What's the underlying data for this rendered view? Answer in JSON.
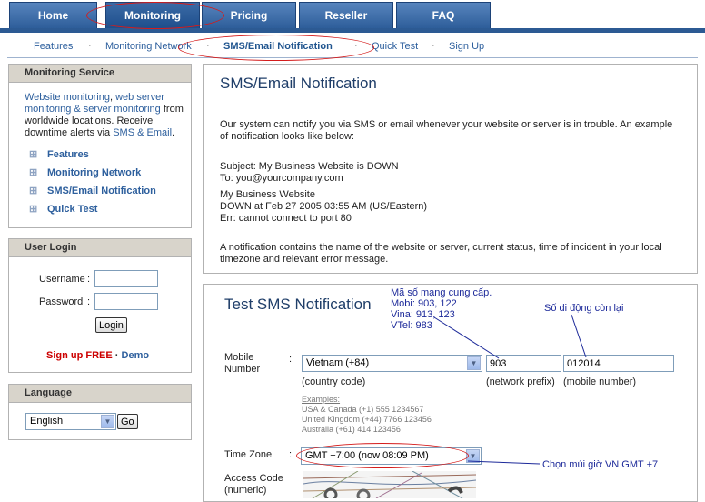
{
  "topnav": {
    "tabs": [
      {
        "label": "Home"
      },
      {
        "label": "Monitoring"
      },
      {
        "label": "Pricing"
      },
      {
        "label": "Reseller"
      },
      {
        "label": "FAQ"
      }
    ]
  },
  "subnav": {
    "items": [
      "Features",
      "Monitoring Network",
      "SMS/Email Notification",
      "Quick Test",
      "Sign Up"
    ],
    "separator": "·"
  },
  "sidebar": {
    "service": {
      "title": "Monitoring Service",
      "desc_link1": "Website monitoring",
      "desc_sep": ",",
      "desc_link2": "web server monitoring & server monitoring",
      "desc_text": "from worldwide locations. Receive downtime alerts via",
      "desc_link3": "SMS & Email",
      "desc_end": ".",
      "items": [
        "Features",
        "Monitoring Network",
        "SMS/Email Notification",
        "Quick Test"
      ],
      "item_icon": "plus-grid-icon"
    },
    "login": {
      "title": "User Login",
      "username_label": "Username",
      "password_label": "Password",
      "colon": ":",
      "login_button": "Login",
      "signup_link": "Sign up FREE",
      "dot": "·",
      "demo_link": "Demo"
    },
    "language": {
      "title": "Language",
      "selected": "English",
      "go_button": "Go"
    }
  },
  "main": {
    "notification": {
      "title": "SMS/Email Notification",
      "intro": "Our system can notify you via SMS or email whenever your website or server is in trouble. An example of notification looks like below:",
      "subject": "Subject: My Business Website is DOWN",
      "to": "To: you@yourcompany.com",
      "body1": "My Business Website",
      "body2": "DOWN at Feb 27 2005 03:55 AM (US/Eastern)",
      "body3": "Err: cannot connect to port 80",
      "footer": "A notification contains the name of the website or server, current status, time of incident in your local timezone and relevant error message."
    },
    "test_sms": {
      "title": "Test SMS Notification",
      "mobile_label_1": "Mobile",
      "mobile_label_2": "Number",
      "colon": ":",
      "country_selected": "Vietnam (+84)",
      "country_caption": "(country code)",
      "network_value": "903",
      "network_caption": "(network prefix)",
      "mobile_value": "012014",
      "mobile_caption": "(mobile number)",
      "examples_title": "Examples:",
      "examples": [
        "USA & Canada (+1) 555 1234567",
        "United Kingdom (+44) 7766 123456",
        "Australia (+61) 414 123456"
      ],
      "timezone_label": "Time Zone",
      "timezone_selected": "GMT +7:00   (now 08:09 PM)",
      "access_label_1": "Access Code",
      "access_label_2": "(numeric)"
    }
  },
  "annotations": {
    "network_note": [
      "Mã số mạng cung cấp.",
      "Mobi: 903, 122",
      "Vina: 913, 123",
      "VTel: 983"
    ],
    "mobile_note": "Số di động còn lại",
    "timezone_note": "Chọn múi giờ VN GMT +7",
    "color_ellipse": "#d41c1c",
    "color_text": "#1d2a9a"
  }
}
